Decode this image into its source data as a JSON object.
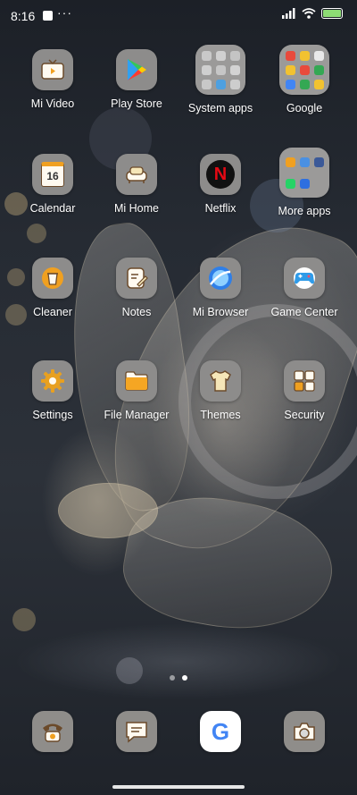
{
  "status": {
    "time": "8:16",
    "battery_color": "#8ddc74"
  },
  "apps": [
    {
      "label": "Mi Video",
      "icon": "tv-icon"
    },
    {
      "label": "Play Store",
      "icon": "play-store-icon"
    },
    {
      "label": "System apps",
      "icon": "folder-icon"
    },
    {
      "label": "Google",
      "icon": "folder-icon"
    },
    {
      "label": "Calendar",
      "icon": "calendar-icon",
      "badge": "16"
    },
    {
      "label": "Mi Home",
      "icon": "mi-home-icon"
    },
    {
      "label": "Netflix",
      "icon": "netflix-icon",
      "glyph": "N"
    },
    {
      "label": "More apps",
      "icon": "folder-icon"
    },
    {
      "label": "Cleaner",
      "icon": "cleaner-icon"
    },
    {
      "label": "Notes",
      "icon": "notes-icon"
    },
    {
      "label": "Mi Browser",
      "icon": "browser-icon"
    },
    {
      "label": "Game Center",
      "icon": "game-controller-icon"
    },
    {
      "label": "Settings",
      "icon": "gear-icon"
    },
    {
      "label": "File Manager",
      "icon": "folder-file-icon"
    },
    {
      "label": "Themes",
      "icon": "tshirt-icon"
    },
    {
      "label": "Security",
      "icon": "security-icon"
    }
  ],
  "dock": [
    {
      "icon": "phone-icon"
    },
    {
      "icon": "messages-icon"
    },
    {
      "icon": "google-chrome-icon",
      "glyph": "G"
    },
    {
      "icon": "camera-icon"
    }
  ],
  "pager": {
    "pages": 2,
    "active": 2
  }
}
